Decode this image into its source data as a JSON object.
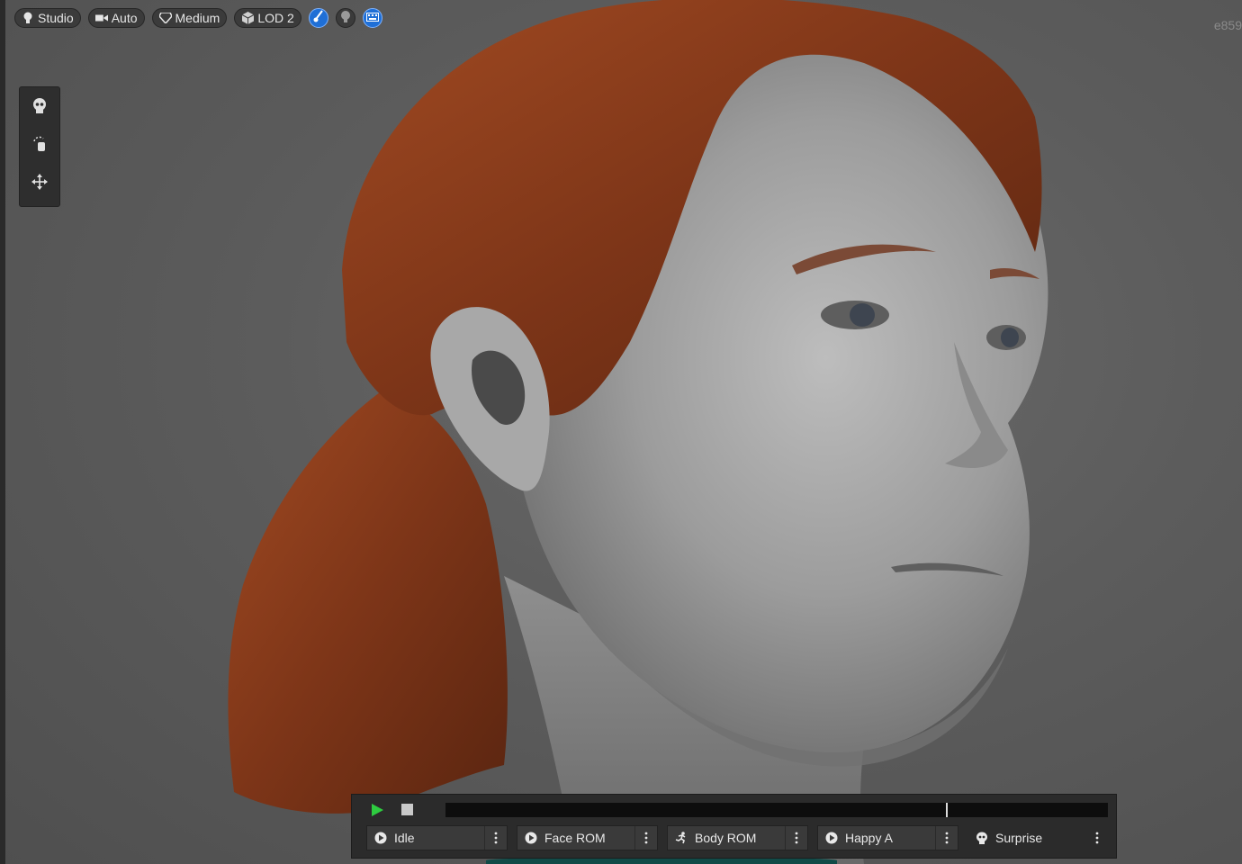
{
  "toolbar": {
    "lighting": {
      "label": "Studio",
      "icon": "lightbulb-icon"
    },
    "camera": {
      "label": "Auto",
      "icon": "camera-icon"
    },
    "quality": {
      "label": "Medium",
      "icon": "diamond-icon"
    },
    "lod": {
      "label": "LOD 2",
      "icon": "cube-icon"
    },
    "toggles": [
      {
        "name": "groom-toggle",
        "icon": "brush-icon",
        "active": true
      },
      {
        "name": "head-toggle",
        "icon": "head-icon",
        "active": false
      },
      {
        "name": "keyboard-toggle",
        "icon": "keyboard-icon",
        "active": true
      }
    ]
  },
  "viewport": {
    "corner_id": "e859"
  },
  "tools": [
    {
      "name": "skull-tool",
      "icon": "skull-icon"
    },
    {
      "name": "rotate-tool",
      "icon": "rotate-hand-icon"
    },
    {
      "name": "move-tool",
      "icon": "move-icon"
    }
  ],
  "timeline": {
    "progress": 0.755
  },
  "animations": [
    {
      "label": "Idle",
      "icon": "play-icon"
    },
    {
      "label": "Face ROM",
      "icon": "play-icon"
    },
    {
      "label": "Body ROM",
      "icon": "running-icon"
    },
    {
      "label": "Happy A",
      "icon": "play-icon"
    },
    {
      "label": "Surprise",
      "icon": "skull-icon"
    }
  ],
  "colors": {
    "accent_blue": "#1f6fd6",
    "play_green": "#2ecc40",
    "hair": "#8a3f1f",
    "skin": "#a6a6a6"
  }
}
